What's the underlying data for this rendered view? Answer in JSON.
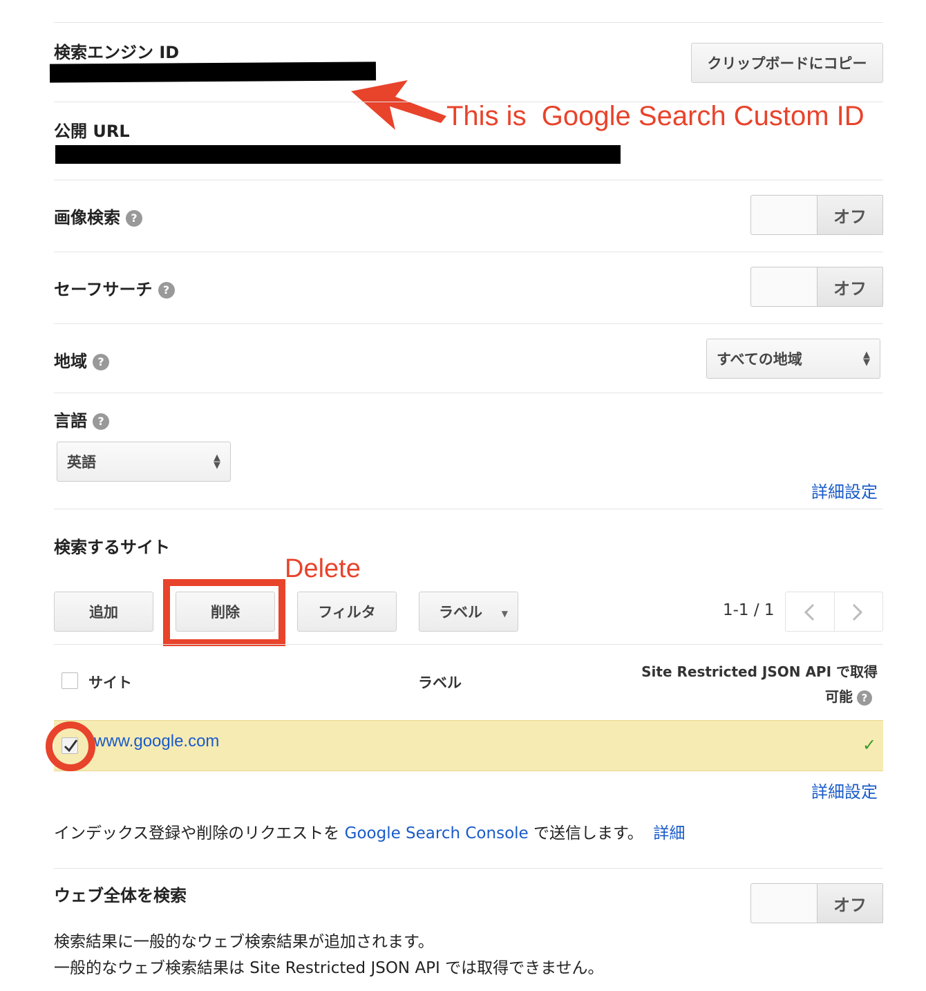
{
  "engine_id": {
    "label": "検索エンジン ID",
    "copy_button": "クリップボードにコピー"
  },
  "annotation_id": "This is  Google Search Custom ID",
  "public_url": {
    "label": "公開 URL"
  },
  "image_search": {
    "label": "画像検索",
    "toggle": "オフ",
    "help_icon": "?"
  },
  "safe_search": {
    "label": "セーフサーチ",
    "toggle": "オフ",
    "help_icon": "?"
  },
  "region": {
    "label": "地域",
    "select_value": "すべての地域",
    "help_icon": "?"
  },
  "language": {
    "label": "言語",
    "select_value": "英語",
    "help_icon": "?",
    "advanced_link": "詳細設定"
  },
  "sites": {
    "title": "検索するサイト",
    "annotation_delete": "Delete",
    "buttons": {
      "add": "追加",
      "delete": "削除",
      "filter": "フィルタ",
      "label": "ラベル"
    },
    "pagination": "1-1 / 1",
    "columns": {
      "site": "サイト",
      "label": "ラベル",
      "json_api_line1": "Site Restricted JSON API で取得",
      "json_api_line2": "可能"
    },
    "rows": [
      {
        "site": "www.google.com",
        "json_api": "✓",
        "checked": true
      }
    ],
    "advanced_link": "詳細設定"
  },
  "index_note": {
    "prefix": "インデックス登録や削除のリクエストを ",
    "console_link": "Google Search Console",
    "suffix": " で送信します。",
    "detail_link": "詳細"
  },
  "web_search": {
    "title": "ウェブ全体を検索",
    "toggle": "オフ",
    "desc_line1": "検索結果に一般的なウェブ検索結果が追加されます。",
    "desc_line2": "一般的なウェブ検索結果は Site Restricted JSON API では取得できません。"
  },
  "colors": {
    "annotation": "#e8432b",
    "link": "#1a5bc9",
    "highlight_row": "#f7ebb4"
  }
}
